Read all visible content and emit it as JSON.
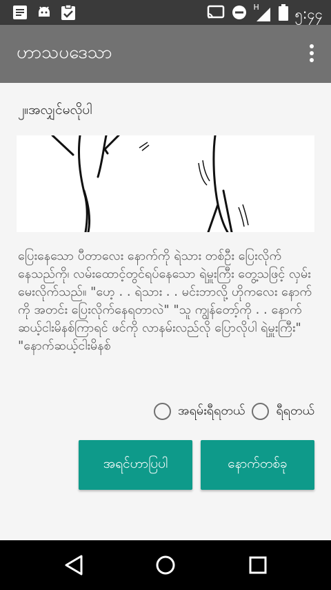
{
  "status_bar": {
    "time": "၅:၄၄",
    "network_label": "H",
    "left_icons": [
      "notes-icon",
      "android-icon",
      "clipboard-check-icon"
    ],
    "right_icons": [
      "cast-icon",
      "do-not-disturb-icon",
      "signal-icon",
      "battery-icon"
    ]
  },
  "app_bar": {
    "title": "ဟာသပဒေသာ",
    "menu_icon": "more-vert-icon"
  },
  "question": {
    "title": "၂။အလျှင်မလိုပါ",
    "story": "ပြေးနေသော ပီတာလေး နောက်ကို ရဲသား တစ်ဦး ပြေးလိုက်နေသည်ကို၊ လမ်းထောင့်တွင်ရပ်နေသော ရဲမှူးကြီး တွေ့သဖြင့် လှမ်းမေးလိုက်သည်။ \"ဟေ့ . . ရဲသား . . မင်းဘာလို့ ဟိုကလေး နောက်ကို အတင်း ပြေးလိုက်နေရတာလဲ\" \"သူ ကျွန်တော့်ကို . . နောက် ဆယ့်ငါးမိနစ်ကြာရင် ဖင်ကို လာနမ်းလည်လို ပြောလိုပါ ရဲမှူးကြီး\" \"နောက်ဆယ့်ငါးမိနစ်"
  },
  "options": [
    {
      "label": "အရမ်းရီရတယ်"
    },
    {
      "label": "ရီရတယ်"
    }
  ],
  "buttons": {
    "prev": "အရင်ဟာပြပါ",
    "next": "နောက်တစ်ခု"
  },
  "nav_bar": {
    "icons": [
      "back-icon",
      "home-icon",
      "recents-icon"
    ]
  },
  "colors": {
    "status_bar": "#3a3a3a",
    "app_bar": "#727272",
    "accent": "#0e9a8a",
    "background": "#f5f5f5"
  }
}
